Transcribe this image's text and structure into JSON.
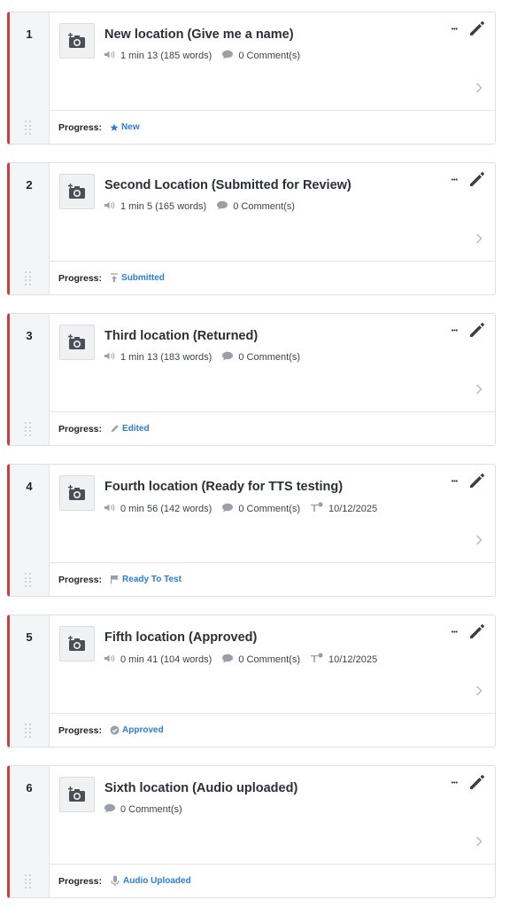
{
  "progress_label": "Progress:",
  "colors": {
    "status_bar": "#d23b3b",
    "progress_text": "#2c7bd6"
  },
  "locations": [
    {
      "number": "1",
      "title": "New location (Give me a name)",
      "duration": "1 min 13 (185 words)",
      "comments": "0 Comment(s)",
      "date": "",
      "progress": "New",
      "progress_icon": "star-icon"
    },
    {
      "number": "2",
      "title": "Second Location (Submitted for Review)",
      "duration": "1 min 5 (165 words)",
      "comments": "0 Comment(s)",
      "date": "",
      "progress": "Submitted",
      "progress_icon": "upload-icon"
    },
    {
      "number": "3",
      "title": "Third location (Returned)",
      "duration": "1 min 13 (183 words)",
      "comments": "0 Comment(s)",
      "date": "",
      "progress": "Edited",
      "progress_icon": "pencil-icon"
    },
    {
      "number": "4",
      "title": "Fourth location (Ready for TTS testing)",
      "duration": "0 min 56 (142 words)",
      "comments": "0 Comment(s)",
      "date": "10/12/2025",
      "progress": "Ready To Test",
      "progress_icon": "flag-icon"
    },
    {
      "number": "5",
      "title": "Fifth location (Approved)",
      "duration": "0 min 41 (104 words)",
      "comments": "0 Comment(s)",
      "date": "10/12/2025",
      "progress": "Approved",
      "progress_icon": "check-circle-icon"
    },
    {
      "number": "6",
      "title": "Sixth location (Audio uploaded)",
      "duration": "",
      "comments": "0 Comment(s)",
      "date": "",
      "progress": "Audio Uploaded",
      "progress_icon": "microphone-icon"
    }
  ]
}
